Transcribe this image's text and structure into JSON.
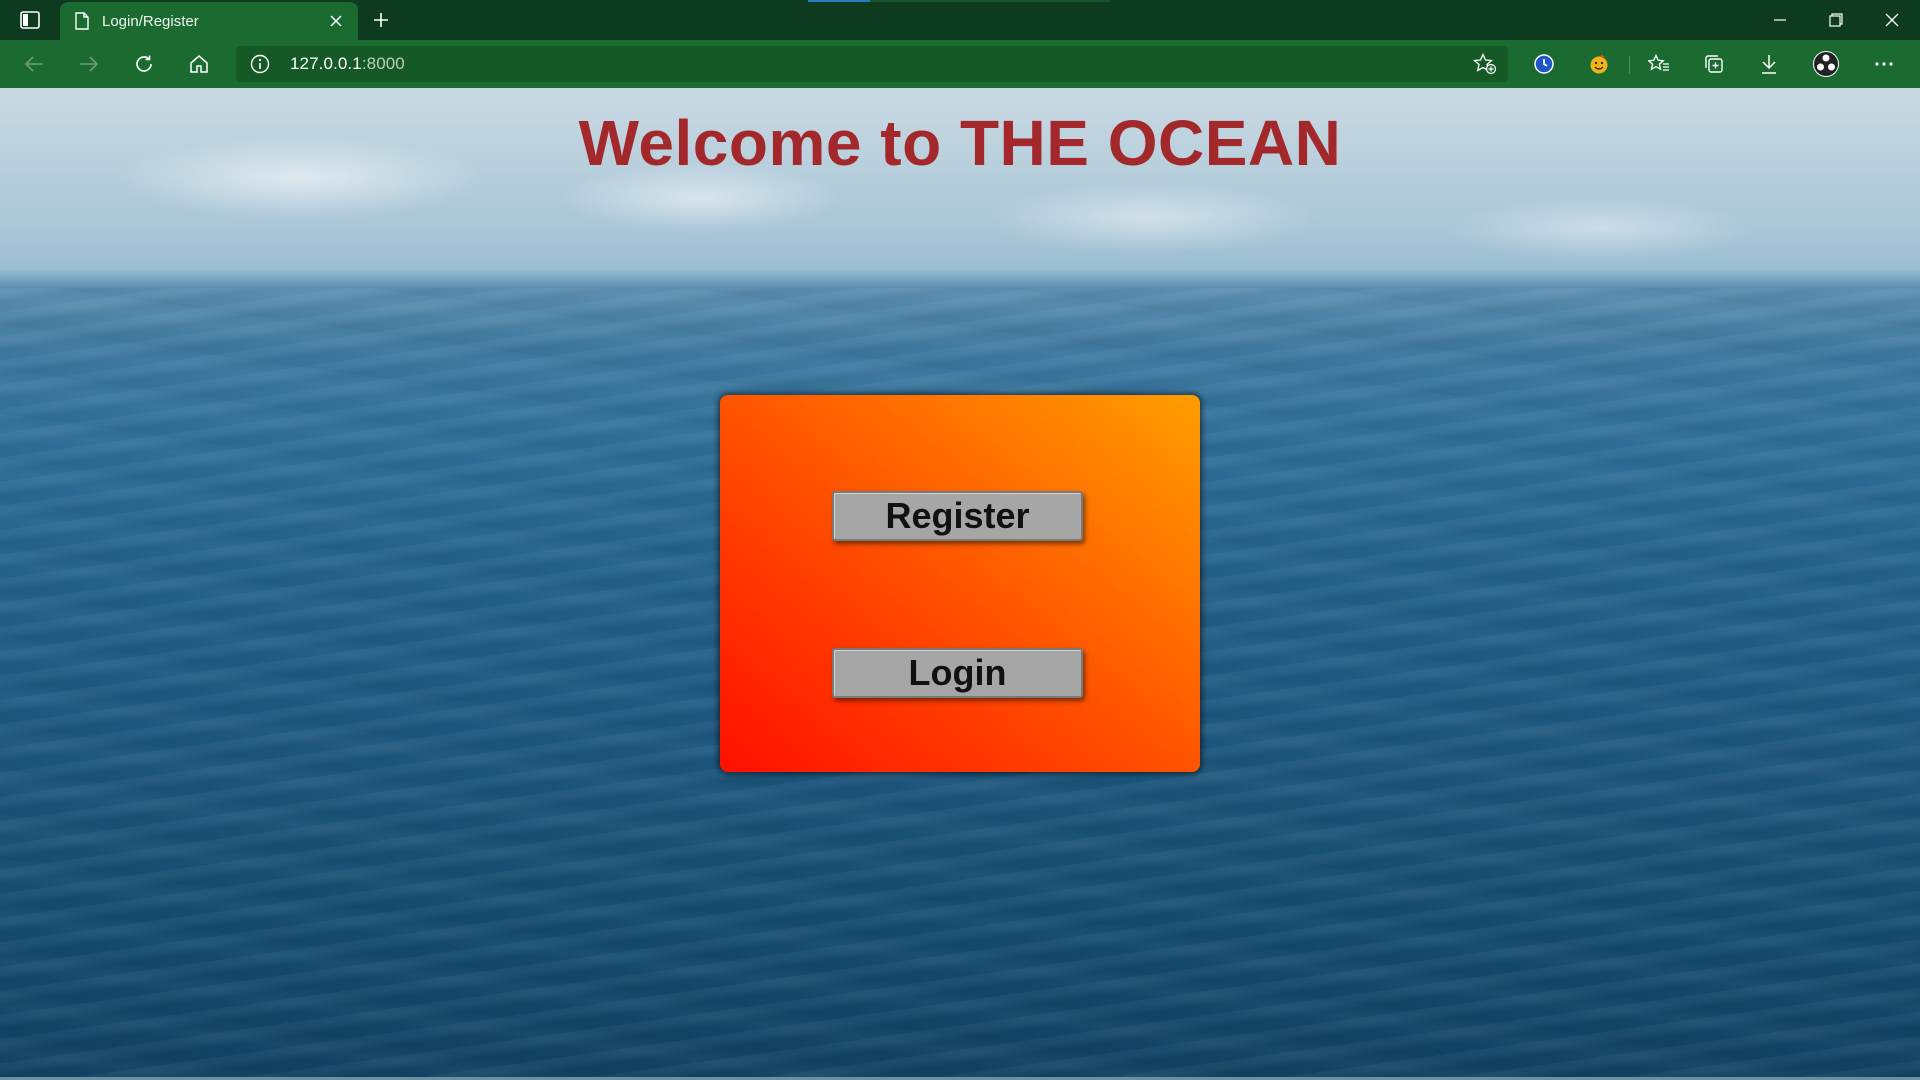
{
  "browser": {
    "tab": {
      "title": "Login/Register"
    },
    "address": {
      "host": "127.0.0.1",
      "port": ":8000"
    },
    "icons": {
      "tab_actions": "tab-actions-icon",
      "page": "page-icon",
      "close_tab": "close-icon",
      "new_tab": "plus-icon",
      "back": "back-arrow-icon",
      "forward": "forward-arrow-icon",
      "refresh": "refresh-icon",
      "home": "home-icon",
      "site_info": "info-icon",
      "add_favorite": "star-add-icon",
      "extension_1": "clock-extension-icon",
      "extension_2": "emoji-extension-icon",
      "favorites": "favorites-icon",
      "collections": "collections-icon",
      "downloads": "download-icon",
      "profile": "profile-avatar-icon",
      "more": "more-icon",
      "minimize": "minimize-icon",
      "restore": "restore-icon",
      "close_window": "close-window-icon"
    },
    "colors": {
      "frame": "#0e3a20",
      "toolbar": "#1b6b30"
    }
  },
  "page": {
    "title": "Welcome to THE OCEAN",
    "buttons": {
      "register": "Register",
      "login": "Login"
    },
    "colors": {
      "title": "#a3282c",
      "panel_start": "#ff1000",
      "panel_end": "#ff9e00",
      "button": "#a6a6a6"
    }
  }
}
